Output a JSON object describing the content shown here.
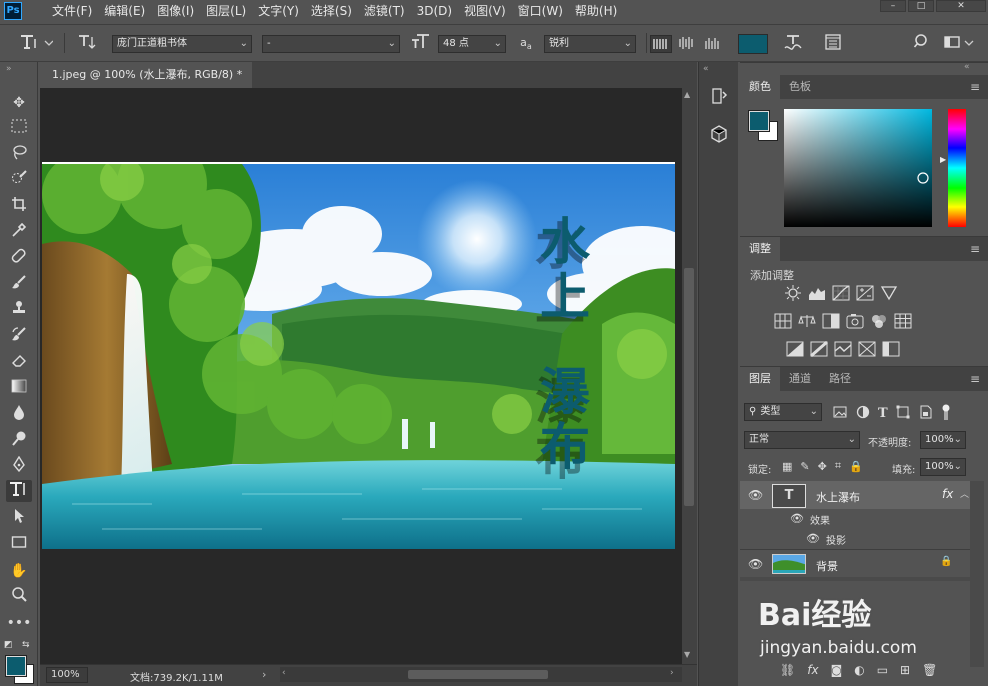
{
  "app": {
    "logo_text": "Ps"
  },
  "menu": [
    "文件(F)",
    "编辑(E)",
    "图像(I)",
    "图层(L)",
    "文字(Y)",
    "选择(S)",
    "滤镜(T)",
    "3D(D)",
    "视图(V)",
    "窗口(W)",
    "帮助(H)"
  ],
  "options": {
    "font_family": "庞门正道粗书体",
    "font_style": "-",
    "font_size": "48 点",
    "aa_icon_text": "a",
    "antialias": "锐利",
    "text_color": "#0c5c6e"
  },
  "document": {
    "tab_title": "1.jpeg @ 100% (水上瀑布, RGB/8) *",
    "tab_close": "×",
    "text_layer_text": "水上瀑布"
  },
  "status": {
    "zoom": "100%",
    "doc_info": "文档:739.2K/1.11M"
  },
  "color_panel": {
    "tabs": [
      "颜色",
      "色板"
    ],
    "foreground": "#0c5c6e",
    "background": "#ffffff"
  },
  "adjust_panel": {
    "tab": "调整",
    "subtitle": "添加调整"
  },
  "layers_panel": {
    "tabs": [
      "图层",
      "通道",
      "路径"
    ],
    "filter_kind": "类型",
    "blend_mode": "正常",
    "opacity_label": "不透明度:",
    "opacity_value": "100%",
    "lock_label": "锁定:",
    "fill_label": "填充:",
    "fill_value": "100%",
    "layers": [
      {
        "name": "水上瀑布",
        "badge": "fx",
        "thumb_glyph": "T"
      },
      {
        "effects_label": "效果"
      },
      {
        "effect_name": "投影"
      },
      {
        "name": "背景",
        "lock": "🔒"
      }
    ]
  },
  "watermark": {
    "brand": "Bai经验",
    "url": "jingyan.baidu.com"
  }
}
